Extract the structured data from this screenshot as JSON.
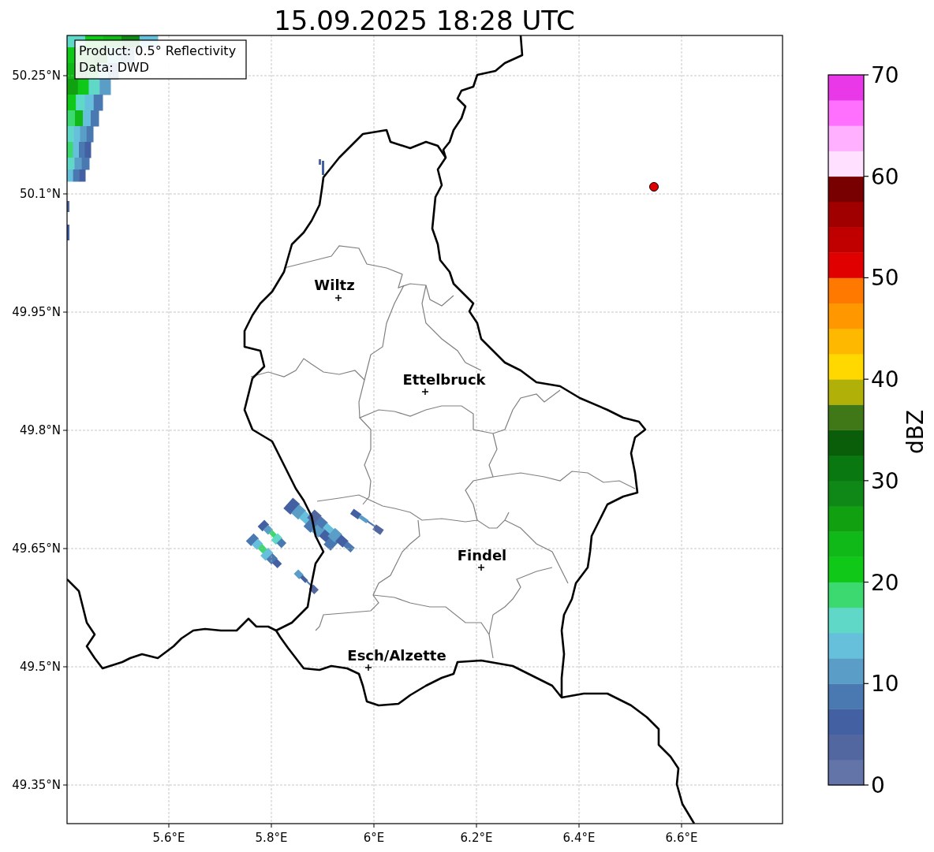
{
  "title": "15.09.2025 18:28 UTC",
  "map": {
    "annotation": [
      "Product: 0.5° Reflectivity",
      "Data: DWD"
    ],
    "lat_ticks": [
      "50.25°N",
      "50.1°N",
      "49.95°N",
      "49.8°N",
      "49.65°N",
      "49.5°N",
      "49.35°N"
    ],
    "lon_ticks": [
      "5.6°E",
      "5.8°E",
      "6°E",
      "6.2°E",
      "6.4°E",
      "6.6°E"
    ],
    "cities": [
      {
        "name": "Wiltz"
      },
      {
        "name": "Ettelbruck"
      },
      {
        "name": "Findel"
      },
      {
        "name": "Esch/Alzette"
      }
    ]
  },
  "colorbar": {
    "label": "dBZ",
    "ticks": [
      "70",
      "60",
      "50",
      "40",
      "30",
      "20",
      "10",
      "0"
    ],
    "bins": [
      {
        "color": "#6374a8"
      },
      {
        "color": "#5266a0"
      },
      {
        "color": "#4360a2"
      },
      {
        "color": "#4a78b0"
      },
      {
        "color": "#5a9ec8"
      },
      {
        "color": "#66c0dc"
      },
      {
        "color": "#60d8c8"
      },
      {
        "color": "#3cd870"
      },
      {
        "color": "#10c818"
      },
      {
        "color": "#10b818"
      },
      {
        "color": "#10a010"
      },
      {
        "color": "#108818"
      },
      {
        "color": "#0a7810"
      },
      {
        "color": "#0a5e0a"
      },
      {
        "color": "#407818"
      },
      {
        "color": "#b0b008"
      },
      {
        "color": "#ffd800"
      },
      {
        "color": "#ffb800"
      },
      {
        "color": "#ff9800"
      },
      {
        "color": "#ff7800"
      },
      {
        "color": "#e00000"
      },
      {
        "color": "#c00000"
      },
      {
        "color": "#a00000"
      },
      {
        "color": "#780000"
      },
      {
        "color": "#ffe0ff"
      },
      {
        "color": "#ffb0ff"
      },
      {
        "color": "#ff70ff"
      },
      {
        "color": "#e838e8"
      }
    ]
  }
}
